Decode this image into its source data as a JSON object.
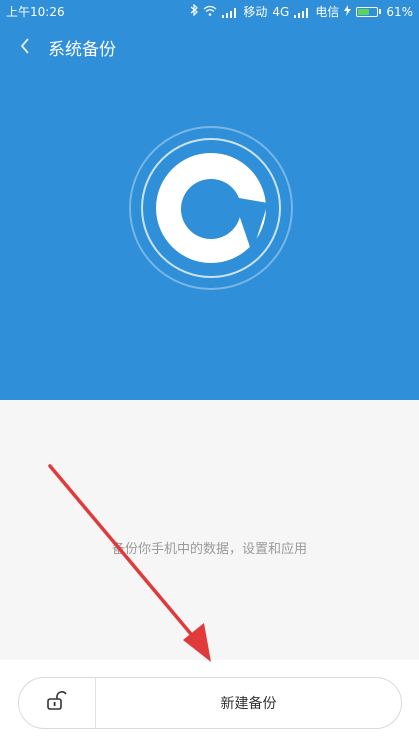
{
  "status_bar": {
    "time": "上午10:26",
    "carrier1": "移动",
    "network": "4G",
    "carrier2": "电信",
    "battery": "61%",
    "battery_level": 0.61
  },
  "header": {
    "back_icon": "chevron-left-icon",
    "title": "系统备份"
  },
  "main": {
    "description": "备份你手机中的数据，设置和应用"
  },
  "actions": {
    "lock_icon": "unlock-icon",
    "new_backup_label": "新建备份"
  },
  "colors": {
    "hero_bg": "#2f8fd8",
    "page_bg": "#f6f6f6",
    "annotation_arrow": "#e03a3a"
  }
}
